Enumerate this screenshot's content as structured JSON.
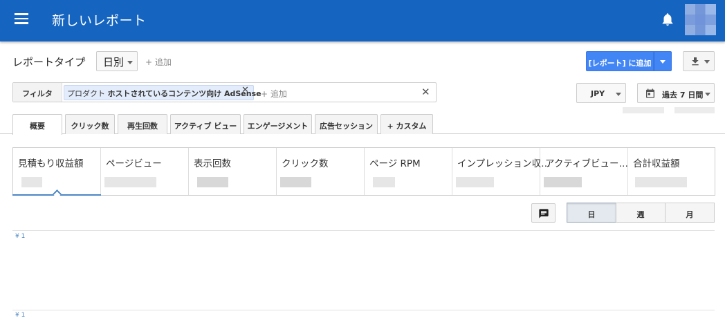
{
  "header": {
    "title": "新しいレポート"
  },
  "toolbar": {
    "report_type_label": "レポートタイプ",
    "granularity_value": "日別",
    "add_label": "+ 追加",
    "add_report_button": "[レポート] に追加"
  },
  "filter": {
    "label": "フィルタ",
    "chip_prefix": "プロダクト",
    "chip_value": "ホストされているコンテンツ向け AdSense",
    "add_placeholder": "+ 追加"
  },
  "currency": "JPY",
  "date_range": "過去 7 日間",
  "tabs": [
    {
      "label": "概要"
    },
    {
      "label": "クリック数"
    },
    {
      "label": "再生回数"
    },
    {
      "label": "アクティブ ビュー"
    },
    {
      "label": "エンゲージメント"
    },
    {
      "label": "広告セッション"
    },
    {
      "label": "+ カスタム"
    }
  ],
  "metrics": [
    {
      "label": "見積もり収益額"
    },
    {
      "label": "ページビュー"
    },
    {
      "label": "表示回数"
    },
    {
      "label": "クリック数"
    },
    {
      "label": "ページ RPM"
    },
    {
      "label": "インプレッション収…"
    },
    {
      "label": "アクティブビュー…"
    },
    {
      "label": "合計収益額"
    }
  ],
  "time_buttons": {
    "day": "日",
    "week": "週",
    "month": "月"
  },
  "chart": {
    "y_tick_top": "¥ 1",
    "y_tick_bottom": "¥ 1"
  }
}
